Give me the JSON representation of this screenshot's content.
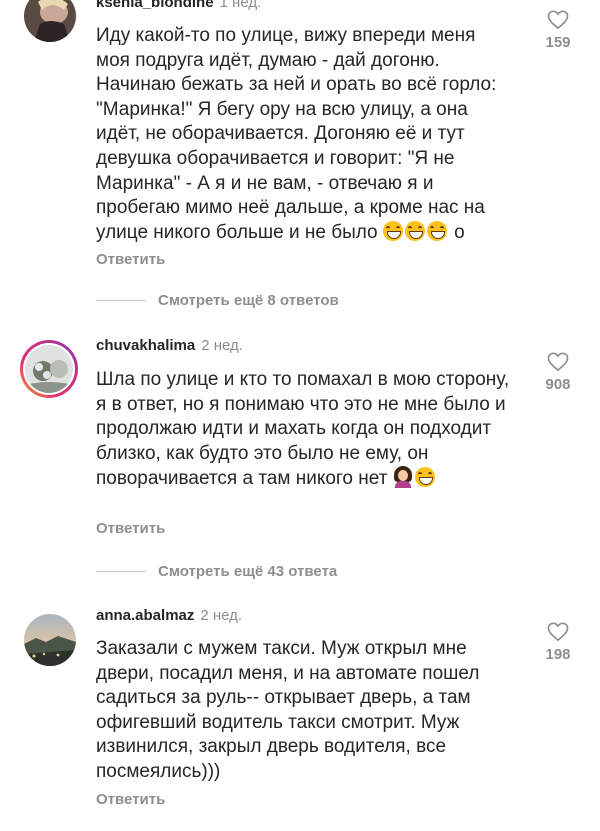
{
  "comments": [
    {
      "username": "ksenia_blondine",
      "time": "1 нед.",
      "text": "Иду какой-то по улице, вижу впереди меня моя подруга идёт, думаю - дай догоню. Начинаю бежать за ней и орать во всё горло: \"Маринка!\" Я бегу ору на всю улицу, а она идёт, не оборачивается. Догоняю её и тут девушка оборачивается и говорит: \"Я не Маринка\" - А я и не вам, - отвечаю я и пробегаю мимо неё дальше, а кроме нас на улице никого больше и не было",
      "text_tail": "о",
      "emojis": [
        "grinning-sweat-emoji",
        "grinning-sweat-emoji",
        "grinning-sweat-emoji"
      ],
      "likes": "159",
      "reply": "Ответить",
      "view_more": "Смотреть ещё 8 ответов"
    },
    {
      "username": "chuvakhalima",
      "time": "2 нед.",
      "text": "Шла по улице и кто то помахал в мою сторону, я в ответ, но я понимаю что это не мне было и продолжаю идти и махать когда он подходит близко, как будто это было не ему, он поворачивается а там никого нет",
      "emojis": [
        "woman-facepalm-emoji",
        "grinning-sweat-emoji"
      ],
      "likes": "908",
      "reply": "Ответить",
      "view_more": "Смотреть ещё 43 ответа"
    },
    {
      "username": "anna.abalmaz",
      "time": "2 нед.",
      "text": "Заказали с мужем такси. Муж открыл мне двери, посадил меня, и на автомате пошел садиться за руль-- открывает дверь, а там офигевший водитель такси смотрит. Муж извинился, закрыл дверь водителя, все посмеялись)))",
      "likes": "198",
      "reply": "Ответить"
    }
  ],
  "icons": {
    "like": "heart-outline-icon"
  },
  "colors": {
    "text": "#262626",
    "muted": "#8e8e8e",
    "story_ring": "#e1306c"
  }
}
